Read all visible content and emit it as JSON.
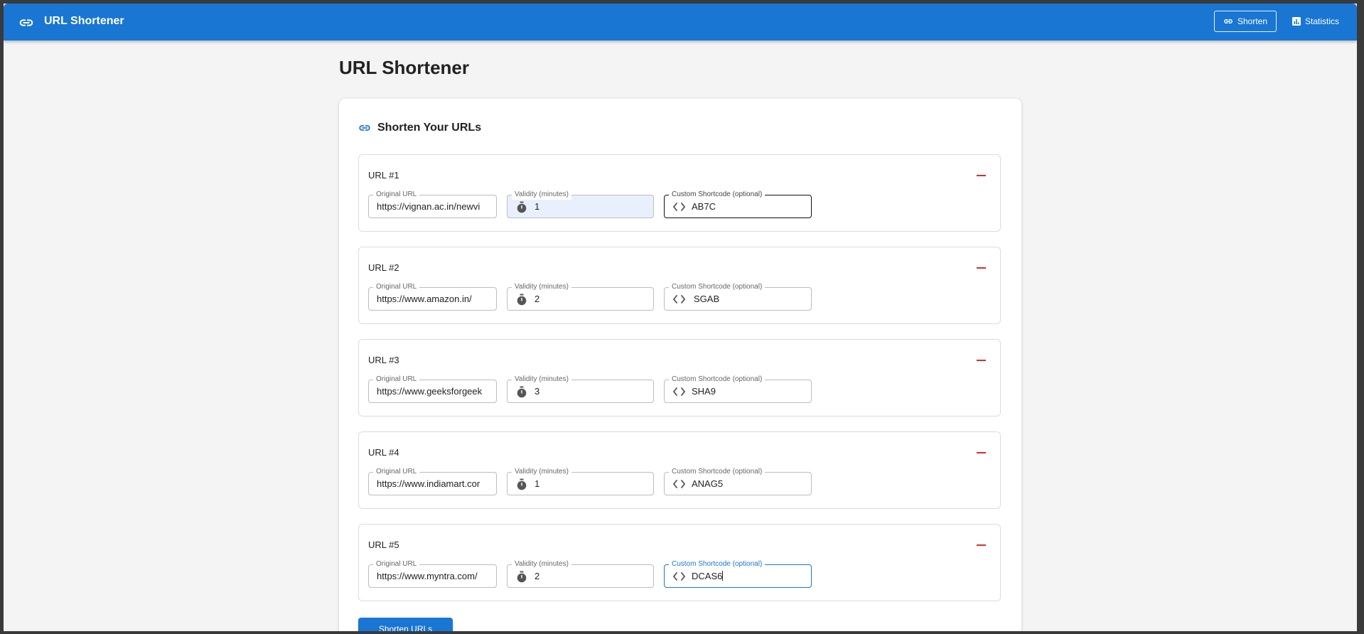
{
  "appbar": {
    "title": "URL Shortener",
    "logo_icon": "link-icon",
    "nav": [
      {
        "label": "Shorten",
        "icon": "link-icon",
        "active": true
      },
      {
        "label": "Statistics",
        "icon": "bar-chart-icon",
        "active": false
      }
    ]
  },
  "page": {
    "title": "URL Shortener"
  },
  "card": {
    "title": "Shorten Your URLs",
    "icon": "link-icon",
    "labels": {
      "original_url": "Original URL",
      "validity": "Validity (minutes)",
      "shortcode": "Custom Shortcode (optional)"
    },
    "urls": [
      {
        "label": "URL #1",
        "url": "https://vignan.ac.in/newvi",
        "validity": "1",
        "shortcode": "AB7C"
      },
      {
        "label": "URL #2",
        "url": "https://www.amazon.in/",
        "validity": "2",
        "shortcode": "SGAB"
      },
      {
        "label": "URL #3",
        "url": "https://www.geeksforgeek",
        "validity": "3",
        "shortcode": "SHA9"
      },
      {
        "label": "URL #4",
        "url": "https://www.indiamart.cor",
        "validity": "1",
        "shortcode": "ANAG5"
      },
      {
        "label": "URL #5",
        "url": "https://www.myntra.com/",
        "validity": "2",
        "shortcode": "DCAS6"
      }
    ],
    "submit_label": "Shorten URLs"
  },
  "colors": {
    "primary": "#1976d2",
    "remove": "#d32f2f",
    "background": "#f4f4f4"
  }
}
